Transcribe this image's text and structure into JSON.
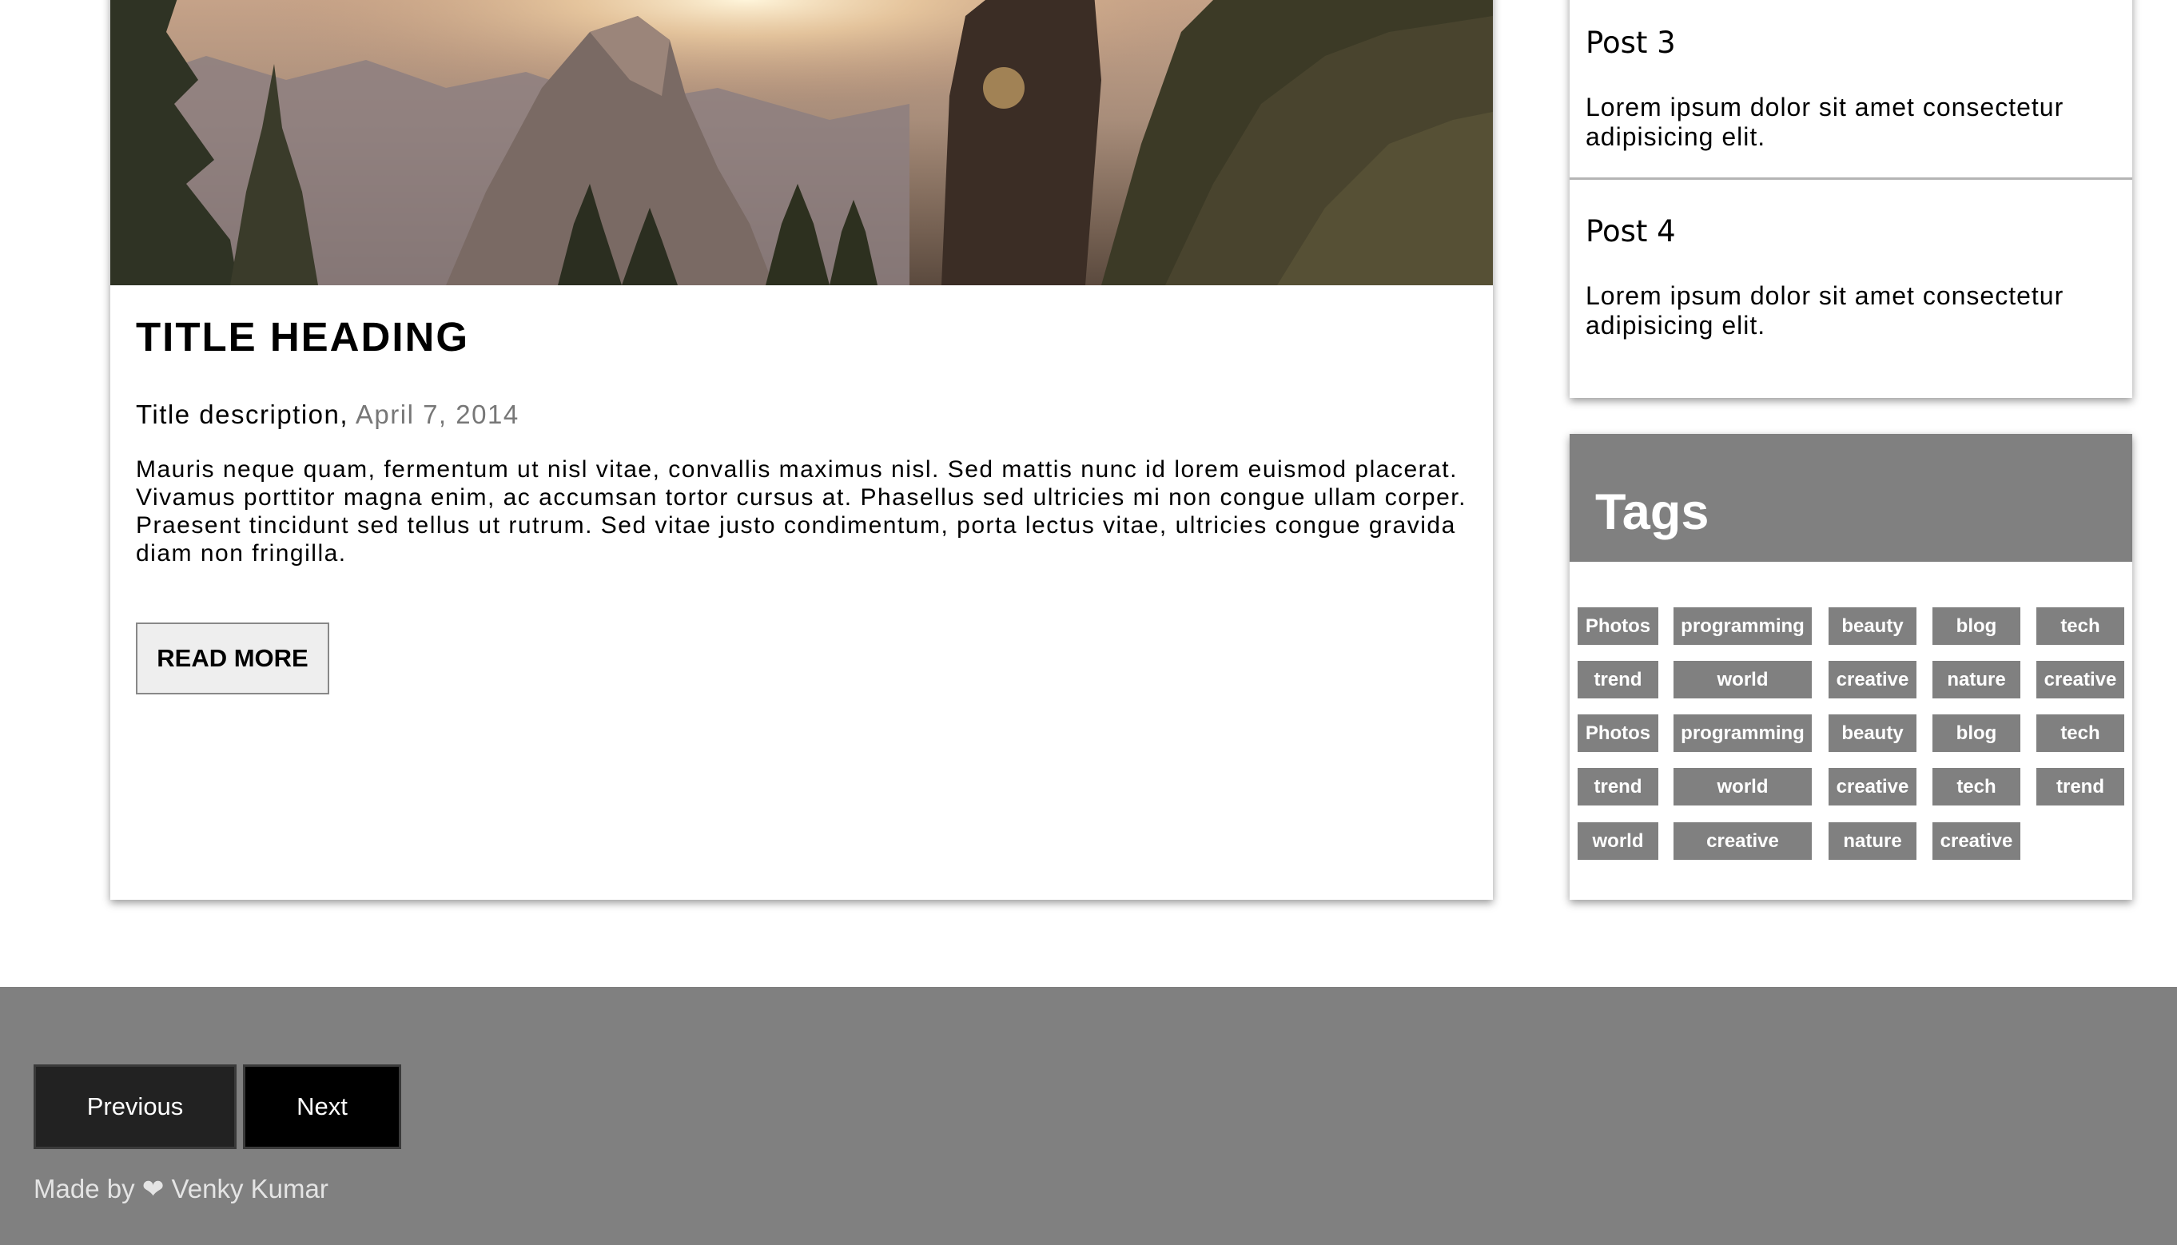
{
  "article": {
    "title": "TITLE HEADING",
    "description": "Title description, ",
    "date": "April 7, 2014",
    "body": "Mauris neque quam, fermentum ut nisl vitae, convallis maximus nisl. Sed mattis nunc id lorem euismod placerat. Vivamus porttitor magna enim, ac accumsan tortor cursus at. Phasellus sed ultricies mi non congue ullam corper. Praesent tincidunt sed tellus ut rutrum. Sed vitae justo condimentum, porta lectus vitae, ultricies congue gravida diam non fringilla.",
    "read_more_label": "READ MORE"
  },
  "posts": [
    {
      "title": "Post 3",
      "text": "Lorem ipsum dolor sit amet consectetur adipisicing elit."
    },
    {
      "title": "Post 4",
      "text": "Lorem ipsum dolor sit amet consectetur adipisicing elit."
    }
  ],
  "tags": {
    "title": "Tags",
    "rows": [
      [
        "Photos",
        "programming",
        "beauty",
        "blog",
        "tech"
      ],
      [
        "trend",
        "world",
        "creative",
        "nature",
        "creative"
      ],
      [
        "Photos",
        "programming",
        "beauty",
        "blog",
        "tech"
      ],
      [
        "trend",
        "world",
        "creative",
        "tech",
        "trend"
      ],
      [
        "world",
        "creative",
        "nature",
        "creative"
      ]
    ]
  },
  "footer": {
    "previous_label": "Previous",
    "next_label": "Next",
    "credit": "Made by ❤ Venky Kumar"
  },
  "colors": {
    "tag_background": "#808080",
    "footer_background": "#808080",
    "date_text": "#777777"
  }
}
